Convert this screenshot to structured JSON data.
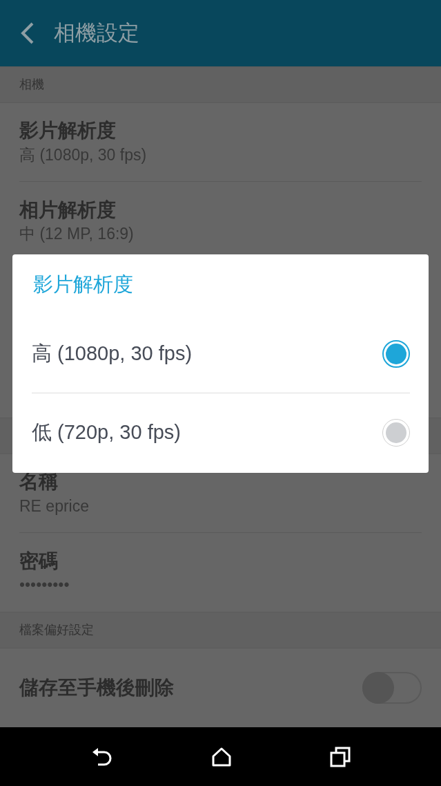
{
  "app_bar": {
    "title": "相機設定"
  },
  "sections": [
    {
      "header": "相機",
      "items": [
        {
          "kind": "value",
          "title": "影片解析度",
          "value": "高 (1080p, 30 fps)"
        },
        {
          "kind": "value",
          "title": "相片解析度",
          "value": "中 (12 MP, 16:9)"
        }
      ]
    },
    {
      "items": [
        {
          "kind": "value",
          "title": "名稱",
          "value": "RE eprice"
        },
        {
          "kind": "password",
          "title": "密碼",
          "value": "•••••••••"
        }
      ]
    },
    {
      "header": "檔案偏好設定",
      "items": [
        {
          "kind": "toggle",
          "title": "儲存至手機後刪除",
          "on": false
        }
      ]
    }
  ],
  "dialog": {
    "title": "影片解析度",
    "options": [
      {
        "label": "高 (1080p, 30 fps)",
        "selected": true
      },
      {
        "label": "低 (720p, 30 fps)",
        "selected": false
      }
    ]
  }
}
